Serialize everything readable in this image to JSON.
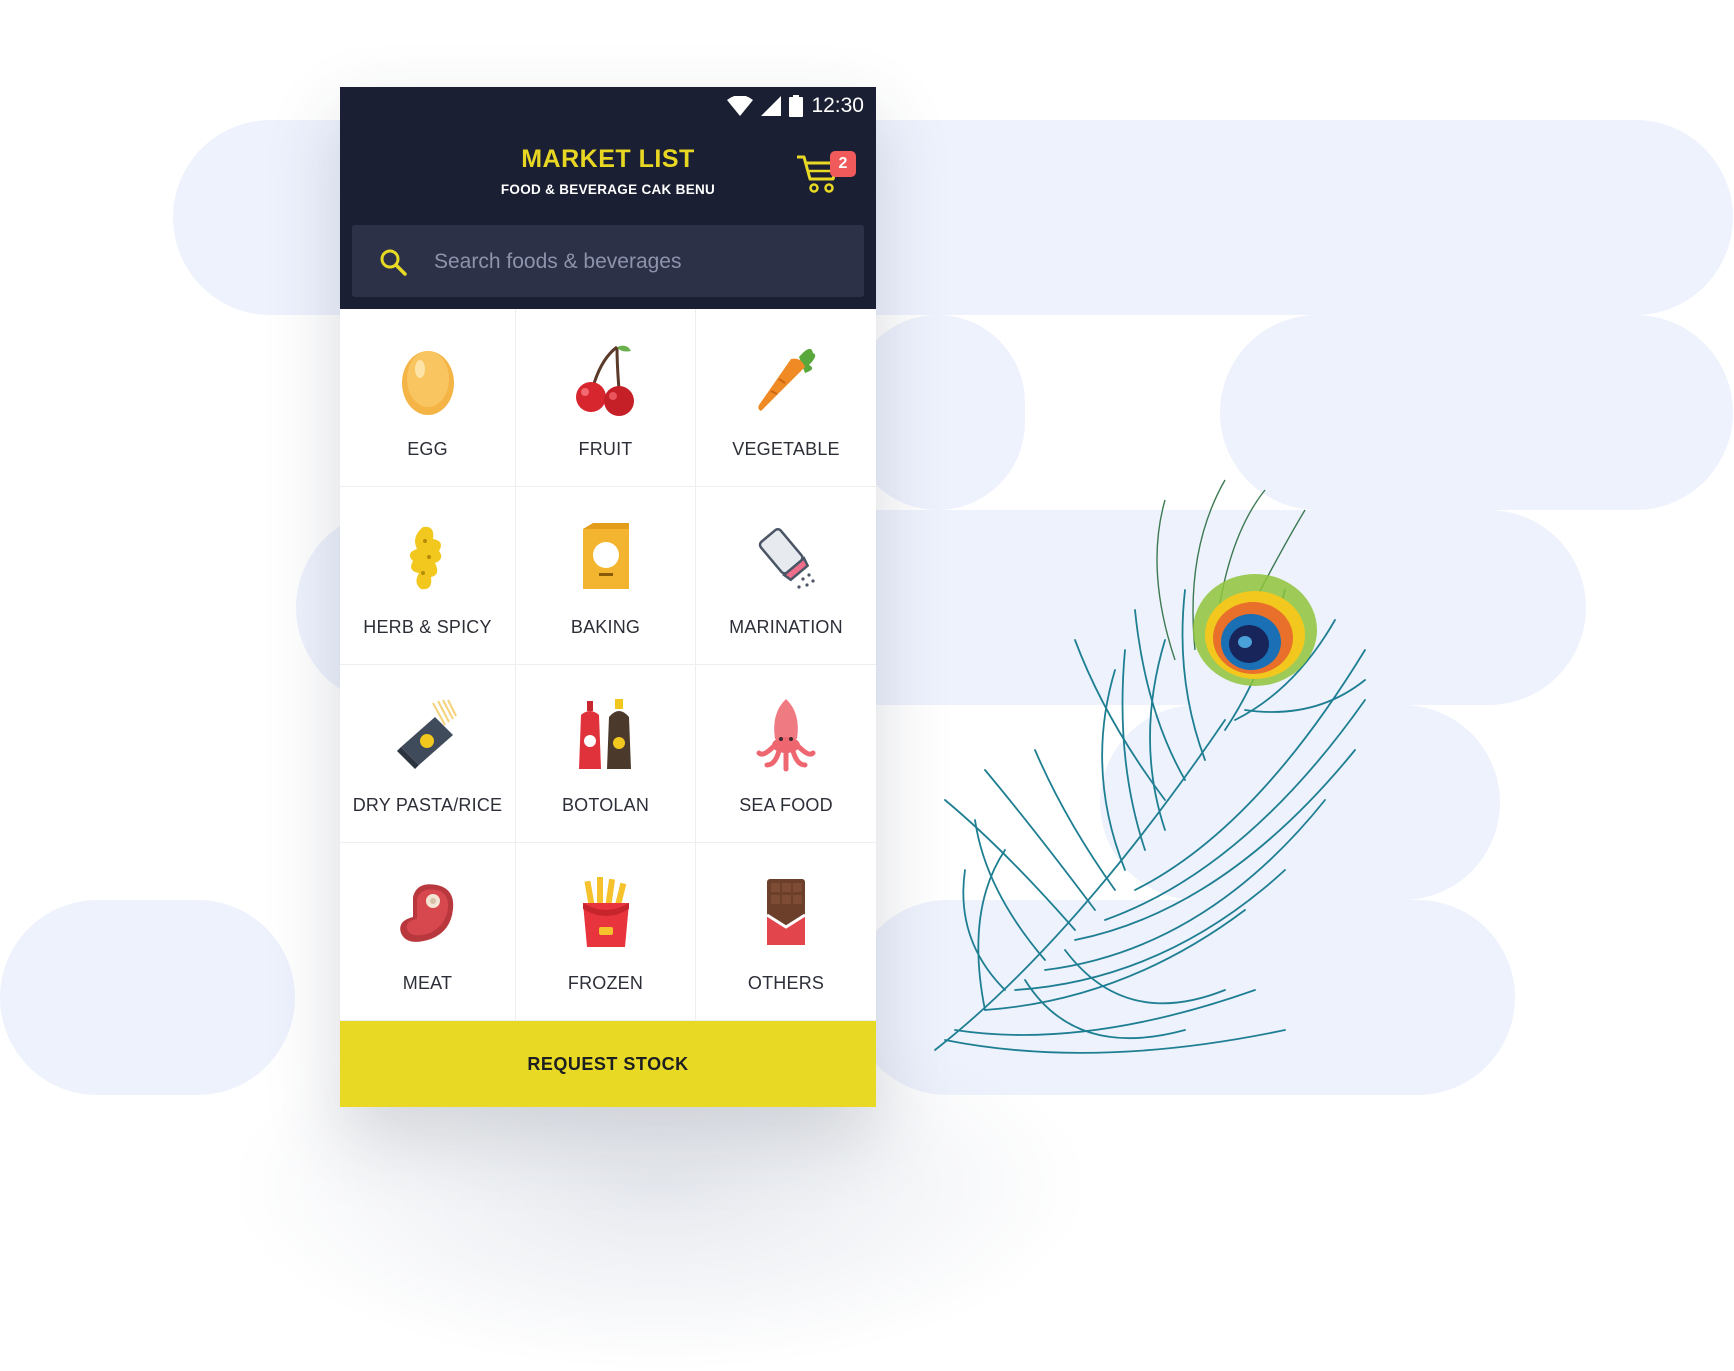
{
  "status_bar": {
    "time": "12:30"
  },
  "header": {
    "title": "MARKET LIST",
    "subtitle": "FOOD & BEVERAGE CAK BENU",
    "cart_count": "2"
  },
  "search": {
    "placeholder": "Search foods & beverages",
    "value": ""
  },
  "categories": [
    {
      "label": "EGG",
      "icon": "egg-icon"
    },
    {
      "label": "FRUIT",
      "icon": "cherry-icon"
    },
    {
      "label": "VEGETABLE",
      "icon": "carrot-icon"
    },
    {
      "label": "HERB & SPICY",
      "icon": "ginger-icon"
    },
    {
      "label": "BAKING",
      "icon": "flour-bag-icon"
    },
    {
      "label": "MARINATION",
      "icon": "salt-shaker-icon"
    },
    {
      "label": "DRY PASTA/RICE",
      "icon": "pasta-pack-icon"
    },
    {
      "label": "BOTOLAN",
      "icon": "sauce-bottles-icon"
    },
    {
      "label": "SEA FOOD",
      "icon": "squid-icon"
    },
    {
      "label": "MEAT",
      "icon": "steak-icon"
    },
    {
      "label": "FROZEN",
      "icon": "fries-icon"
    },
    {
      "label": "OTHERS",
      "icon": "chocolate-bar-icon"
    }
  ],
  "footer": {
    "request_label": "REQUEST STOCK"
  },
  "colors": {
    "header_bg": "#1b1f33",
    "accent_yellow": "#e8d925",
    "badge_red": "#f05a5a",
    "search_bg": "#2c3148"
  }
}
